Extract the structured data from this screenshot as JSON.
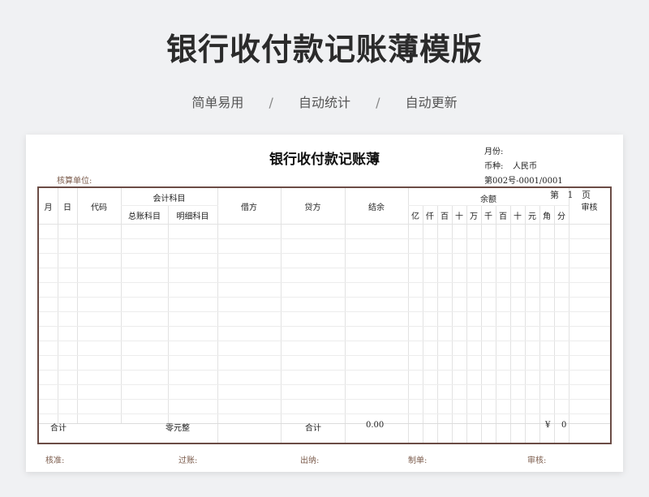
{
  "banner": {
    "title": "银行收付款记账薄模版",
    "features": [
      "简单易用",
      "自动统计",
      "自动更新"
    ],
    "separator": "/"
  },
  "sheet": {
    "title": "银行收付款记账薄",
    "month_label": "月份:",
    "currency_label": "币种:",
    "currency_value": "人民币",
    "doc_number": "第002号-0001/0001",
    "unit_label": "核算单位:",
    "page_prefix": "第",
    "page_number": "1",
    "page_suffix": "页"
  },
  "table": {
    "headers": {
      "month": "月",
      "day": "日",
      "code": "代码",
      "account": "会计科目",
      "general_account": "总账科目",
      "detail_account": "明细科目",
      "debit": "借方",
      "credit": "贷方",
      "balance_note": "结余",
      "balance": "余额",
      "audit": "审核"
    },
    "digit_units": [
      "亿",
      "仟",
      "百",
      "十",
      "万",
      "千",
      "百",
      "十",
      "元",
      "角",
      "分"
    ],
    "footer": {
      "total_label": "合计",
      "amount_in_words": "零元整",
      "total_label_2": "合计",
      "balance_total": "0.00",
      "currency_symbol": "¥",
      "currency_total": "0"
    }
  },
  "signatures": {
    "approve": "核准:",
    "post": "过账:",
    "cashier": "出纳:",
    "prepare": "制单:",
    "audit": "审核:"
  },
  "colors": {
    "border": "#6b4c45",
    "label_brown": "#7a5a4a",
    "background": "#f0f1f3"
  }
}
